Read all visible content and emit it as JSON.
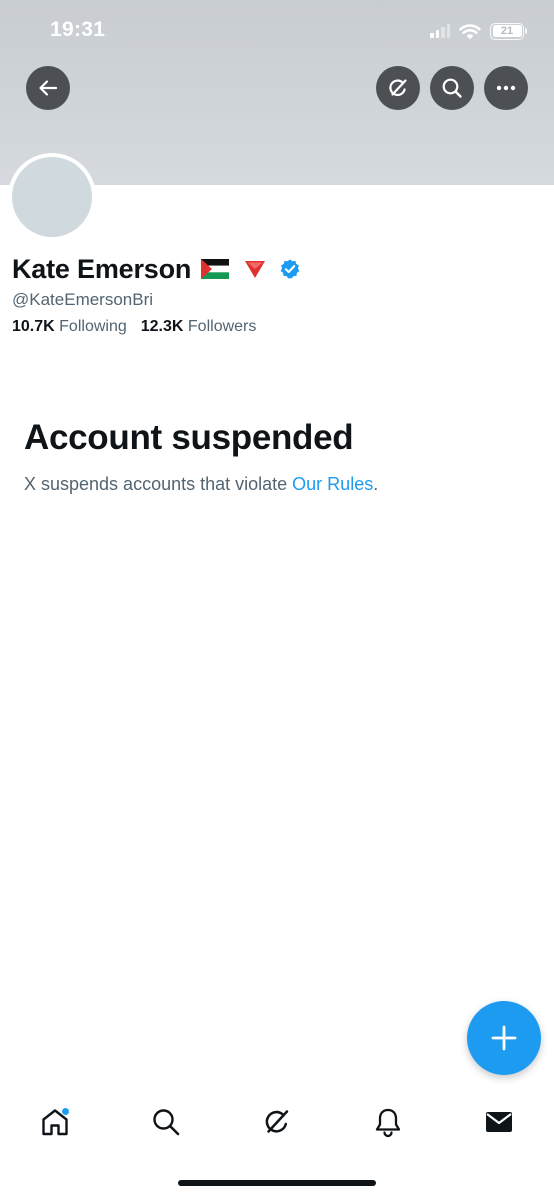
{
  "status_bar": {
    "time": "19:31",
    "battery_level": "21",
    "icons": [
      "signal-icon",
      "wifi-icon",
      "battery-icon"
    ]
  },
  "header": {
    "icons": [
      "back-arrow-icon",
      "grok-icon",
      "search-icon",
      "more-horizontal-icon"
    ]
  },
  "profile": {
    "display_name": "Kate Emerson",
    "name_icons": [
      "palestine-flag-icon",
      "red-triangle-icon",
      "verified-badge-icon"
    ],
    "handle": "@KateEmersonBri",
    "following_count": "10.7K",
    "following_label": "Following",
    "followers_count": "12.3K",
    "followers_label": "Followers"
  },
  "suspension": {
    "title": "Account suspended",
    "message": "X suspends accounts that violate ",
    "link_text": "Our Rules",
    "message_end": "."
  },
  "fab": {
    "icon": "plus-icon"
  },
  "bottom_nav": {
    "items": [
      "home-icon",
      "search-icon",
      "grok-icon",
      "notifications-bell-icon",
      "messages-envelope-icon"
    ]
  },
  "colors": {
    "accent": "#1d9bf0",
    "text_primary": "#0f1419",
    "text_secondary": "#536471",
    "banner": "#cfd4d8",
    "flag_red": "#e0312f",
    "flag_green": "#149954"
  }
}
